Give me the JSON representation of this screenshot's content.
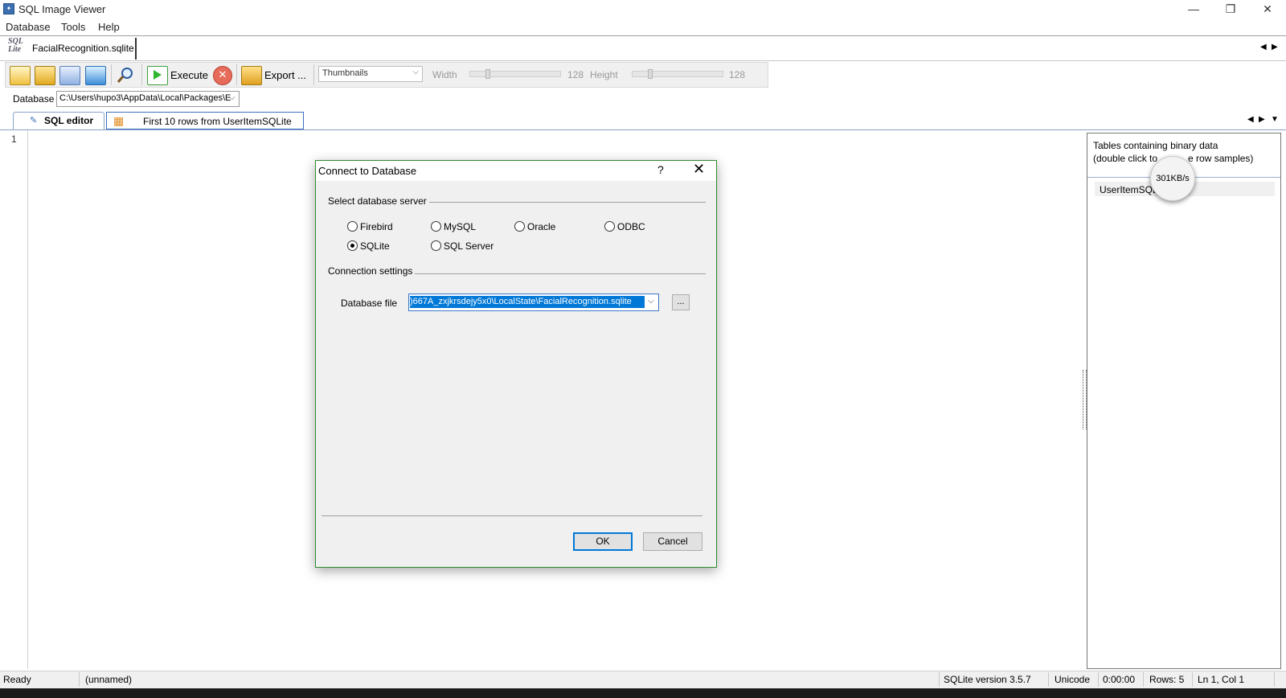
{
  "window": {
    "title": "SQL Image Viewer",
    "minimize_glyph": "—",
    "restore_glyph": "❐",
    "close_glyph": "✕"
  },
  "menu": [
    "Database",
    "Tools",
    "Help"
  ],
  "doc_tab": {
    "icon_text": "SQL Lite",
    "label": "FacialRecognition.sqlite"
  },
  "toolbar": {
    "execute_label": "Execute",
    "export_label": "Export ...",
    "view_mode": "Thumbnails",
    "width_label": "Width",
    "width_value": "128",
    "height_label": "Height",
    "height_value": "128"
  },
  "database_row": {
    "label": "Database",
    "path": "C:\\Users\\hupo3\\AppData\\Local\\Packages\\E"
  },
  "editor_tabs": [
    {
      "label": "SQL editor",
      "active": true
    },
    {
      "label": "First 10 rows from UserItemSQLite",
      "active": false
    }
  ],
  "editor": {
    "line_number": "1"
  },
  "right_panel": {
    "heading_line1": "Tables containing binary data",
    "heading_line2_left": "(double click to",
    "heading_line2_right": "e row samples)",
    "items": [
      "UserItemSQL"
    ],
    "speed_overlay": "301KB/s"
  },
  "dialog": {
    "title": "Connect to Database",
    "help_glyph": "?",
    "close_glyph": "✕",
    "server_group_label": "Select database server",
    "servers": [
      {
        "name": "Firebird",
        "checked": false
      },
      {
        "name": "MySQL",
        "checked": false
      },
      {
        "name": "Oracle",
        "checked": false
      },
      {
        "name": "ODBC",
        "checked": false
      },
      {
        "name": "SQLite",
        "checked": true
      },
      {
        "name": "SQL Server",
        "checked": false
      }
    ],
    "connection_group_label": "Connection settings",
    "database_file_label": "Database file",
    "database_file_value": ")667A_zxjkrsdejy5x0\\LocalState\\FacialRecognition.sqlite",
    "browse_label": "...",
    "ok_label": "OK",
    "cancel_label": "Cancel"
  },
  "status_bar": {
    "state": "Ready",
    "name": "(unnamed)",
    "version": "SQLite version 3.5.7",
    "encoding": "Unicode",
    "time": "0:00:00",
    "rows": "Rows: 5",
    "position": "Ln 1, Col 1"
  }
}
